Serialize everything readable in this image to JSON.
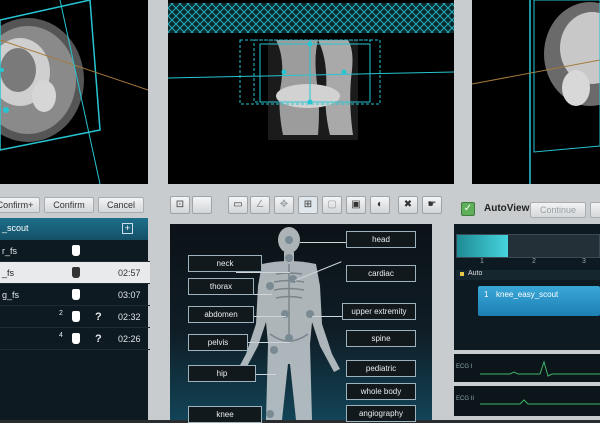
{
  "toolbar_buttons": {
    "confirm_plus": "Confirm+",
    "confirm": "Confirm",
    "cancel": "Cancel"
  },
  "protocol_list": {
    "header": "_scout",
    "add_icon": "plus-icon",
    "rows": [
      {
        "name": "r_fs",
        "time": "",
        "count": "",
        "help": ""
      },
      {
        "name": "_fs",
        "time": "02:57",
        "count": "",
        "help": ""
      },
      {
        "name": "g_fs",
        "time": "03:07",
        "count": "",
        "help": ""
      },
      {
        "name": "",
        "time": "02:32",
        "count": "2",
        "help": "?"
      },
      {
        "name": "",
        "time": "02:26",
        "count": "4",
        "help": "?"
      }
    ]
  },
  "body_regions": {
    "left": [
      "neck",
      "thorax",
      "abdomen",
      "pelvis",
      "hip",
      "knee"
    ],
    "right": [
      "head",
      "cardiac",
      "upper extremity",
      "spine",
      "pediatric",
      "whole body",
      "angiography"
    ]
  },
  "autoview": {
    "label": "AutoView",
    "checked": true,
    "continue_label": "Continue"
  },
  "timeline": {
    "ticks": [
      "1",
      "2",
      "3"
    ],
    "progress": 0.36
  },
  "queue": {
    "header": "Auto",
    "item_index": "1",
    "item_name": "knee_easy_scout"
  },
  "ecg_labels": [
    "ECG I",
    "ECG II"
  ],
  "colors": {
    "accent": "#27c5d2",
    "panel": "#0e1a21",
    "frame": "#c9ccce"
  }
}
